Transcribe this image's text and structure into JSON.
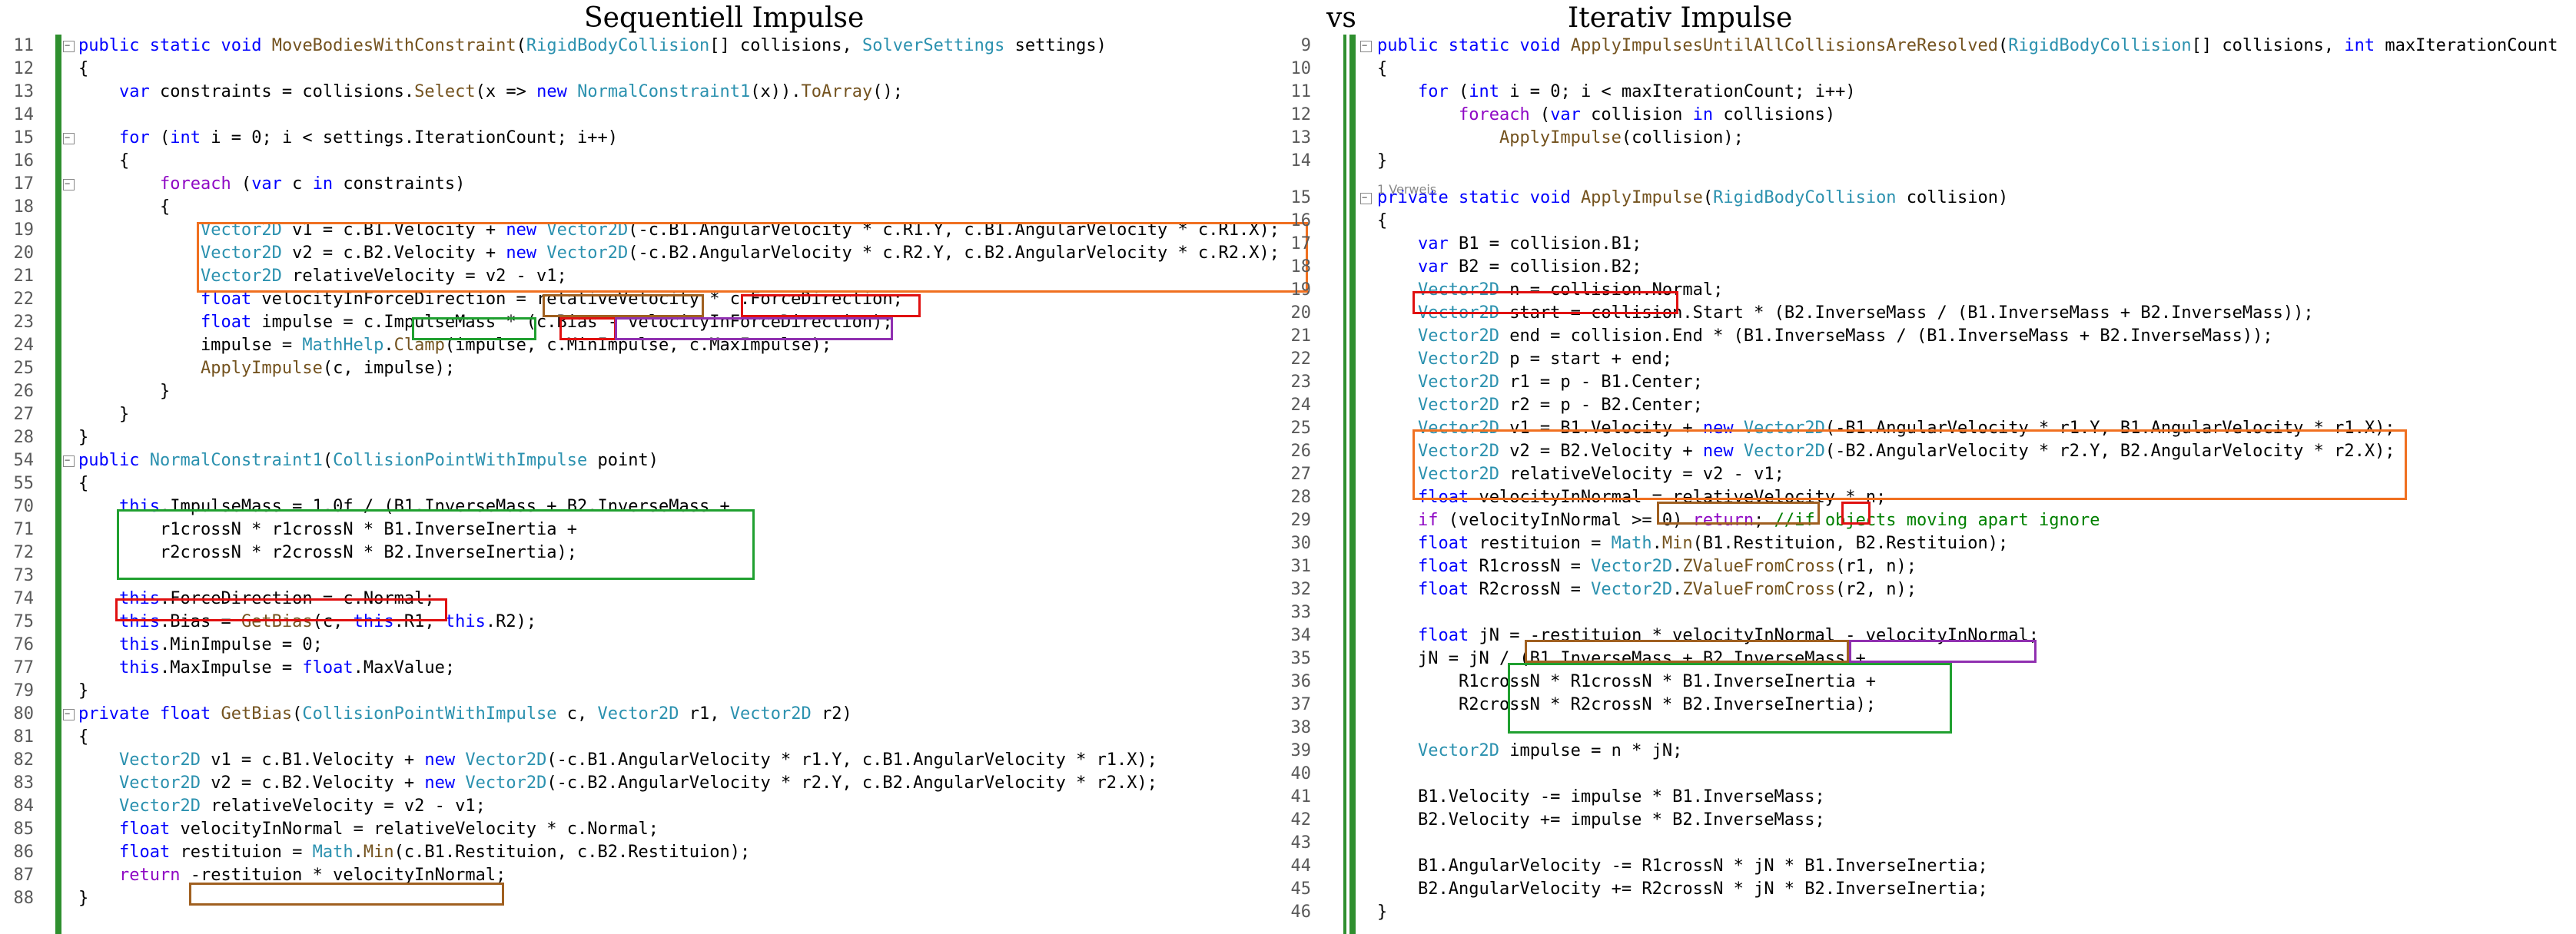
{
  "titles": {
    "left": "Sequentiell Impulse",
    "vs": "vs",
    "right": "Iterativ Impulse"
  },
  "reference_hint": "1 Verweis",
  "colors": {
    "keyword": "#0000ff",
    "type": "#2b91af",
    "method": "#74531f",
    "comment": "#008000",
    "control": "#8f08c4",
    "gutter": "#2f8f2f",
    "box_orange": "#f07020",
    "box_red": "#e01010",
    "box_green": "#20a030",
    "box_purple": "#9030b0"
  },
  "left_code": [
    {
      "n": "11",
      "t": "public static void MoveBodiesWithConstraint(RigidBodyCollision[] collisions, SolverSettings settings)"
    },
    {
      "n": "12",
      "t": "{"
    },
    {
      "n": "13",
      "t": "    var constraints = collisions.Select(x => new NormalConstraint1(x)).ToArray();"
    },
    {
      "n": "14",
      "t": ""
    },
    {
      "n": "15",
      "t": "    for (int i = 0; i < settings.IterationCount; i++)"
    },
    {
      "n": "16",
      "t": "    {"
    },
    {
      "n": "17",
      "t": "        foreach (var c in constraints)"
    },
    {
      "n": "18",
      "t": "        {"
    },
    {
      "n": "19",
      "t": "            Vector2D v1 = c.B1.Velocity + new Vector2D(-c.B1.AngularVelocity * c.R1.Y, c.B1.AngularVelocity * c.R1.X);"
    },
    {
      "n": "20",
      "t": "            Vector2D v2 = c.B2.Velocity + new Vector2D(-c.B2.AngularVelocity * c.R2.Y, c.B2.AngularVelocity * c.R2.X);"
    },
    {
      "n": "21",
      "t": "            Vector2D relativeVelocity = v2 - v1;"
    },
    {
      "n": "22",
      "t": "            float velocityInForceDirection = relativeVelocity * c.ForceDirection;"
    },
    {
      "n": "23",
      "t": "            float impulse = c.ImpulseMass * (c.Bias - velocityInForceDirection);"
    },
    {
      "n": "24",
      "t": "            impulse = MathHelp.Clamp(impulse, c.MinImpulse, c.MaxImpulse);"
    },
    {
      "n": "25",
      "t": "            ApplyImpulse(c, impulse);"
    },
    {
      "n": "26",
      "t": "        }"
    },
    {
      "n": "27",
      "t": "    }"
    },
    {
      "n": "28",
      "t": "}"
    },
    {
      "n": "54",
      "t": "public NormalConstraint1(CollisionPointWithImpulse point)"
    },
    {
      "n": "55",
      "t": "{"
    },
    {
      "n": "70",
      "t": "    this.ImpulseMass = 1.0f / (B1.InverseMass + B2.InverseMass +"
    },
    {
      "n": "71",
      "t": "        r1crossN * r1crossN * B1.InverseInertia +"
    },
    {
      "n": "72",
      "t": "        r2crossN * r2crossN * B2.InverseInertia);"
    },
    {
      "n": "73",
      "t": ""
    },
    {
      "n": "74",
      "t": "    this.ForceDirection = c.Normal;"
    },
    {
      "n": "75",
      "t": "    this.Bias = GetBias(c, this.R1, this.R2);"
    },
    {
      "n": "76",
      "t": "    this.MinImpulse = 0;"
    },
    {
      "n": "77",
      "t": "    this.MaxImpulse = float.MaxValue;"
    },
    {
      "n": "79",
      "t": "}"
    },
    {
      "n": "80",
      "t": "private float GetBias(CollisionPointWithImpulse c, Vector2D r1, Vector2D r2)"
    },
    {
      "n": "81",
      "t": "{"
    },
    {
      "n": "82",
      "t": "    Vector2D v1 = c.B1.Velocity + new Vector2D(-c.B1.AngularVelocity * r1.Y, c.B1.AngularVelocity * r1.X);"
    },
    {
      "n": "83",
      "t": "    Vector2D v2 = c.B2.Velocity + new Vector2D(-c.B2.AngularVelocity * r2.Y, c.B2.AngularVelocity * r2.X);"
    },
    {
      "n": "84",
      "t": "    Vector2D relativeVelocity = v2 - v1;"
    },
    {
      "n": "85",
      "t": "    float velocityInNormal = relativeVelocity * c.Normal;"
    },
    {
      "n": "86",
      "t": "    float restituion = Math.Min(c.B1.Restituion, c.B2.Restituion);"
    },
    {
      "n": "87",
      "t": "    return -restituion * velocityInNormal;"
    },
    {
      "n": "88",
      "t": "}"
    }
  ],
  "right_code": [
    {
      "n": "9",
      "t": "public static void ApplyImpulsesUntilAllCollisionsAreResolved(RigidBodyCollision[] collisions, int maxIterationCount"
    },
    {
      "n": "10",
      "t": "{"
    },
    {
      "n": "11",
      "t": "    for (int i = 0; i < maxIterationCount; i++)"
    },
    {
      "n": "12",
      "t": "        foreach (var collision in collisions)"
    },
    {
      "n": "13",
      "t": "            ApplyImpulse(collision);"
    },
    {
      "n": "14",
      "t": "}"
    },
    {
      "n": "15",
      "t": "private static void ApplyImpulse(RigidBodyCollision collision)"
    },
    {
      "n": "16",
      "t": "{"
    },
    {
      "n": "17",
      "t": "    var B1 = collision.B1;"
    },
    {
      "n": "18",
      "t": "    var B2 = collision.B2;"
    },
    {
      "n": "19",
      "t": "    Vector2D n = collision.Normal;"
    },
    {
      "n": "20",
      "t": "    Vector2D start = collision.Start * (B2.InverseMass / (B1.InverseMass + B2.InverseMass));"
    },
    {
      "n": "21",
      "t": "    Vector2D end = collision.End * (B1.InverseMass / (B1.InverseMass + B2.InverseMass));"
    },
    {
      "n": "22",
      "t": "    Vector2D p = start + end;"
    },
    {
      "n": "23",
      "t": "    Vector2D r1 = p - B1.Center;"
    },
    {
      "n": "24",
      "t": "    Vector2D r2 = p - B2.Center;"
    },
    {
      "n": "25",
      "t": "    Vector2D v1 = B1.Velocity + new Vector2D(-B1.AngularVelocity * r1.Y, B1.AngularVelocity * r1.X);"
    },
    {
      "n": "26",
      "t": "    Vector2D v2 = B2.Velocity + new Vector2D(-B2.AngularVelocity * r2.Y, B2.AngularVelocity * r2.X);"
    },
    {
      "n": "27",
      "t": "    Vector2D relativeVelocity = v2 - v1;"
    },
    {
      "n": "28",
      "t": "    float velocityInNormal = relativeVelocity * n;"
    },
    {
      "n": "29",
      "t": "    if (velocityInNormal >= 0) return; //if objects moving apart ignore"
    },
    {
      "n": "30",
      "t": "    float restituion = Math.Min(B1.Restituion, B2.Restituion);"
    },
    {
      "n": "31",
      "t": "    float R1crossN = Vector2D.ZValueFromCross(r1, n);"
    },
    {
      "n": "32",
      "t": "    float R2crossN = Vector2D.ZValueFromCross(r2, n);"
    },
    {
      "n": "33",
      "t": ""
    },
    {
      "n": "34",
      "t": "    float jN = -restituion * velocityInNormal - velocityInNormal;"
    },
    {
      "n": "35",
      "t": "    jN = jN / (B1.InverseMass + B2.InverseMass +"
    },
    {
      "n": "36",
      "t": "        R1crossN * R1crossN * B1.InverseInertia +"
    },
    {
      "n": "37",
      "t": "        R2crossN * R2crossN * B2.InverseInertia);"
    },
    {
      "n": "38",
      "t": ""
    },
    {
      "n": "39",
      "t": "    Vector2D impulse = n * jN;"
    },
    {
      "n": "40",
      "t": ""
    },
    {
      "n": "41",
      "t": "    B1.Velocity -= impulse * B1.InverseMass;"
    },
    {
      "n": "42",
      "t": "    B2.Velocity += impulse * B2.InverseMass;"
    },
    {
      "n": "43",
      "t": ""
    },
    {
      "n": "44",
      "t": "    B1.AngularVelocity -= R1crossN * jN * B1.InverseInertia;"
    },
    {
      "n": "45",
      "t": "    B2.AngularVelocity += R2crossN * jN * B2.InverseInertia;"
    },
    {
      "n": "46",
      "t": "}"
    }
  ]
}
